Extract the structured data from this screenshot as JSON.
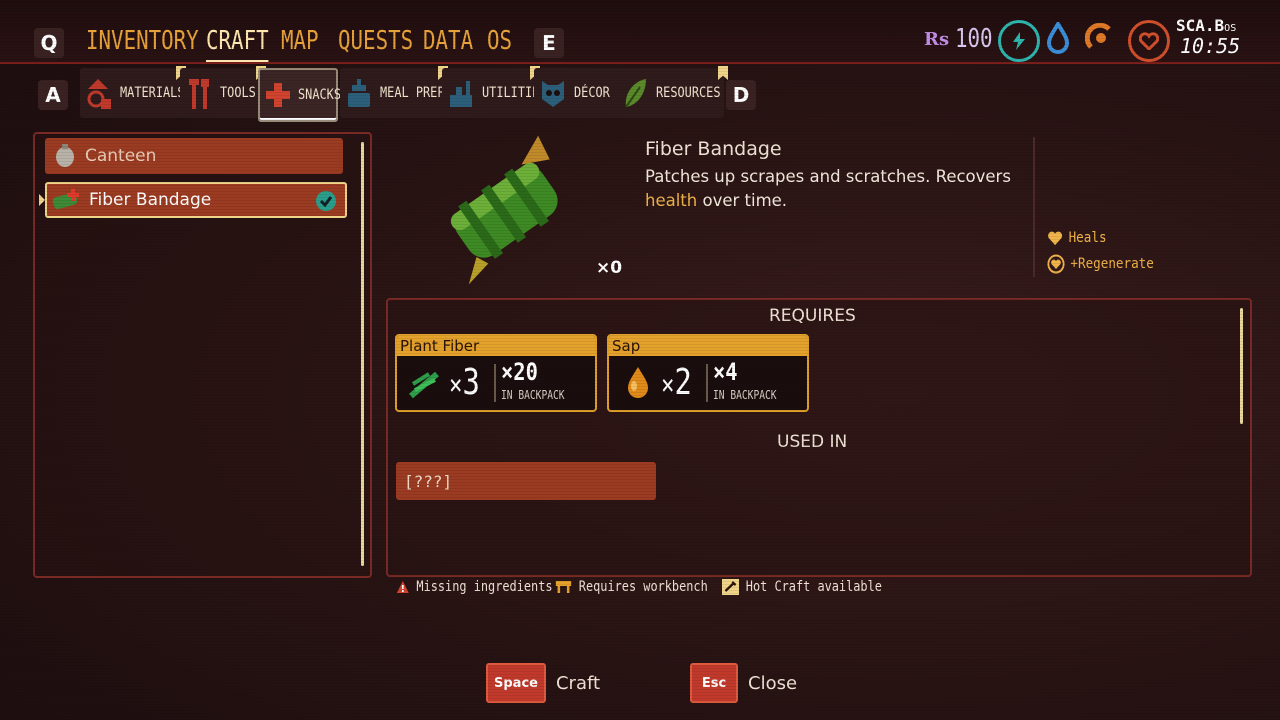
{
  "topnav": {
    "left_key": "Q",
    "right_key": "E",
    "tabs": [
      {
        "label": "INVENTORY",
        "active": false
      },
      {
        "label": "CRAFT",
        "active": true
      },
      {
        "label": "MAP",
        "active": false
      },
      {
        "label": "QUESTS",
        "active": false
      },
      {
        "label": "DATA",
        "active": false
      },
      {
        "label": "OS",
        "active": false
      }
    ],
    "currency": {
      "icon": "raw-science-icon",
      "symbol": "Rs",
      "value": "100"
    },
    "stats": [
      {
        "icon": "stamina-icon",
        "color": "#2fb5b0"
      },
      {
        "icon": "water-drop-icon",
        "color": "#3a8fd8"
      },
      {
        "icon": "food-icon",
        "color": "#e07a28"
      },
      {
        "icon": "health-heart-icon",
        "color": "#d0502c"
      }
    ],
    "clock": {
      "label": "SCA.B",
      "suffix": "OS",
      "time": "10:55"
    }
  },
  "categories": {
    "left_key": "A",
    "right_key": "D",
    "items": [
      {
        "label": "MATERIALS",
        "icon": "materials-icon",
        "new": true,
        "active": false
      },
      {
        "label": "TOOLS",
        "icon": "tools-icon",
        "new": true,
        "active": false
      },
      {
        "label": "SNACKS",
        "icon": "snacks-cross-icon",
        "new": false,
        "active": true
      },
      {
        "label": "MEAL PREP",
        "icon": "meal-prep-icon",
        "new": true,
        "active": false
      },
      {
        "label": "UTILITIES",
        "icon": "utilities-icon",
        "new": true,
        "active": false
      },
      {
        "label": "DÉCOR",
        "icon": "decor-icon",
        "new": false,
        "active": false
      },
      {
        "label": "RESOURCES",
        "icon": "resources-leaf-icon",
        "new": true,
        "active": false
      }
    ]
  },
  "recipes": [
    {
      "label": "Canteen",
      "icon": "canteen-icon",
      "selected": false,
      "craftable": false
    },
    {
      "label": "Fiber Bandage",
      "icon": "fiber-bandage-icon",
      "selected": true,
      "craftable": true
    }
  ],
  "detail": {
    "name": "Fiber Bandage",
    "desc_part1": "Patches up scrapes and scratches. Recovers",
    "desc_highlight": "health",
    "desc_part2": " over time.",
    "count": "×0",
    "effects": [
      {
        "label": "Heals",
        "icon": "heart-icon"
      },
      {
        "label": "+Regenerate",
        "icon": "regenerate-heart-icon"
      }
    ]
  },
  "requires": {
    "title": "REQUIRES",
    "ingredients": [
      {
        "name": "Plant Fiber",
        "icon": "plant-fiber-icon",
        "qty_x": "×",
        "qty": "3",
        "have": "×20",
        "backpack": "IN BACKPACK"
      },
      {
        "name": "Sap",
        "icon": "sap-drop-icon",
        "qty_x": "×",
        "qty": "2",
        "have": "×4",
        "backpack": "IN BACKPACK"
      }
    ],
    "used_in_title": "USED IN",
    "used_in": [
      "[???]"
    ]
  },
  "legend": [
    {
      "label": "Missing ingredients",
      "icon": "warning-icon"
    },
    {
      "label": "Requires workbench",
      "icon": "workbench-icon"
    },
    {
      "label": "Hot Craft available",
      "icon": "hot-craft-icon"
    }
  ],
  "actions": [
    {
      "key": "Space",
      "label": "Craft"
    },
    {
      "key": "Esc",
      "label": "Close"
    }
  ]
}
